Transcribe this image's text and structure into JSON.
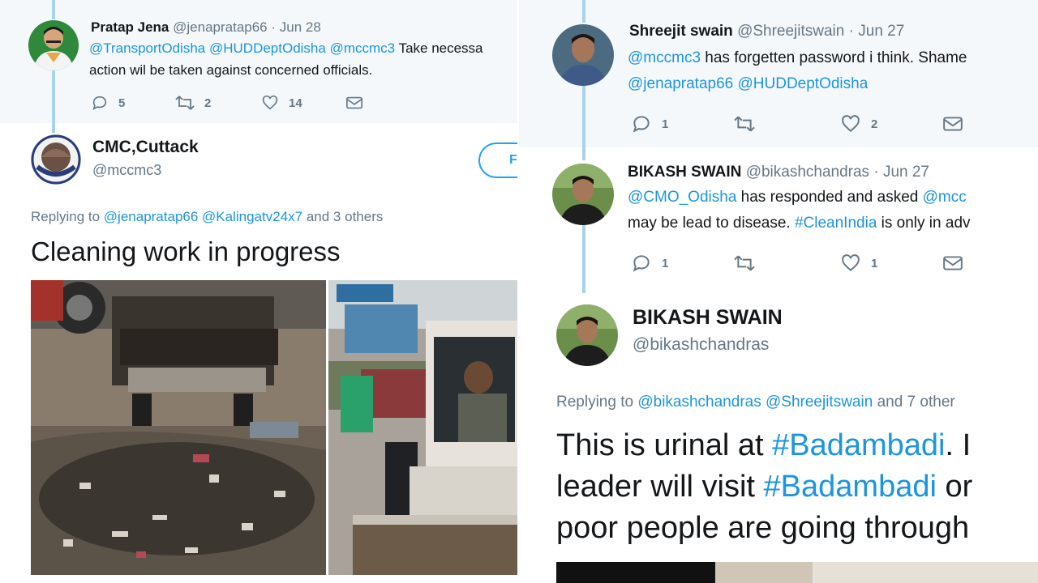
{
  "left": {
    "tweet1": {
      "name": "Pratap Jena",
      "handle": "@jenapratap66",
      "sep": "·",
      "date": "Jun 28",
      "line1_mentions": [
        "@TransportOdisha",
        "@HUDDeptOdisha",
        "@mccmc3"
      ],
      "line1_rest": "Take necessa",
      "line2": "action wil be taken against concerned officials.",
      "replies": "5",
      "retweets": "2",
      "likes": "14"
    },
    "main_tweet": {
      "name": "CMC,Cuttack",
      "handle": "@mccmc3",
      "follow_label": "F",
      "replying_prefix": "Replying to",
      "replying_mentions": [
        "@jenapratap66",
        "@Kalingatv24x7"
      ],
      "replying_suffix": "and 3 others",
      "text": "Cleaning work in progress"
    }
  },
  "right": {
    "tweet1": {
      "name": "Shreejit swain",
      "handle": "@Shreejitswain",
      "sep": "·",
      "date": "Jun 27",
      "line1_mention": "@mccmc3",
      "line1_rest": "has forgetten password i think. Shame",
      "line2_mentions": [
        "@jenapratap66",
        "@HUDDeptOdisha"
      ],
      "replies": "1",
      "retweets": "",
      "likes": "2"
    },
    "tweet2": {
      "name": "BIKASH SWAIN",
      "handle": "@bikashchandras",
      "sep": "·",
      "date": "Jun 27",
      "line1_mention": "@CMO_Odisha",
      "line1_rest": "has responded and asked",
      "line1_mention2": "@mcc",
      "line2_pre": "may be lead to disease.",
      "line2_hashtag": "#CleanIndia",
      "line2_post": "is only in adv",
      "replies": "1",
      "retweets": "",
      "likes": "1"
    },
    "main_tweet": {
      "name": "BIKASH SWAIN",
      "handle": "@bikashchandras",
      "replying_prefix": "Replying to",
      "replying_mentions": [
        "@bikashchandras",
        "@Shreejitswain"
      ],
      "replying_suffix": "and 7 other",
      "line1_pre": "This is urinal at",
      "line1_hashtag": "#Badambadi",
      "line1_post": ". I",
      "line2_pre": "leader will visit",
      "line2_hashtag": "#Badambadi",
      "line2_post": "or",
      "line3": "poor people are going through"
    }
  },
  "colors": {
    "link": "#1b95e0",
    "thread_line": "#a6d3ee",
    "grey_bg": "#f5f8fa",
    "secondary_text": "#657786"
  },
  "icons": [
    "reply-icon",
    "retweet-icon",
    "like-icon",
    "dm-icon"
  ]
}
